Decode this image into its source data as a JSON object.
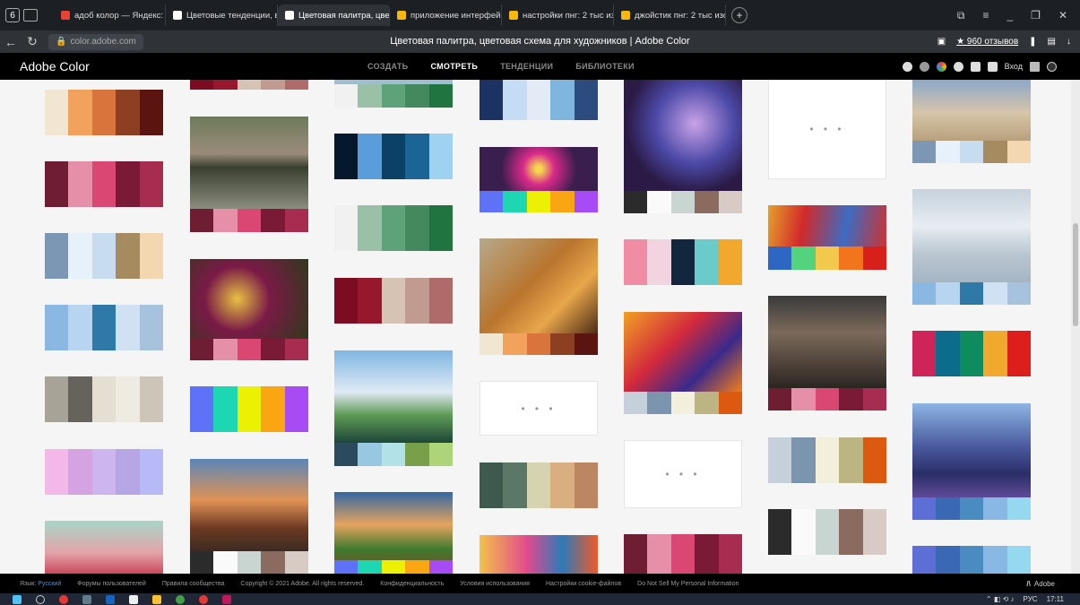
{
  "browser": {
    "tab_count": "6",
    "tabs": [
      {
        "label": "адоб колор — Яндекс: на",
        "color": "#e94234"
      },
      {
        "label": "Цветовые тенденции, вдо",
        "color": "#ffffff"
      },
      {
        "label": "Цветовая палитра, цве",
        "color": "#ffffff",
        "active": true
      },
      {
        "label": "приложение интерфейс:",
        "color": "#f6b80b"
      },
      {
        "label": "настройки пнг: 2 тыс изоб",
        "color": "#f6b80b"
      },
      {
        "label": "джойстик пнг: 2 тыс изоб",
        "color": "#f6b80b"
      }
    ],
    "url": "color.adobe.com",
    "page_title": "Цветовая палитра, цветовая схема для художников | Adobe Color",
    "reviews": "★ 960 отзывов"
  },
  "adobe": {
    "brand": "Adobe Color",
    "nav": [
      {
        "label": "СОЗДАТЬ",
        "active": false
      },
      {
        "label": "СМОТРЕТЬ",
        "active": true
      },
      {
        "label": "ТЕНДЕНЦИИ",
        "active": false
      },
      {
        "label": "БИБЛИОТЕКИ",
        "active": false
      }
    ],
    "login": "Вход"
  },
  "palettes": [
    [
      "#f1e6d2",
      "#f2a25d",
      "#d9743d",
      "#8d3f21",
      "#5c1410"
    ],
    [
      "#6e1d33",
      "#e58fa8",
      "#d94772",
      "#7a1a36",
      "#a62d50"
    ],
    [
      "#7c97b4",
      "#e7f1fb",
      "#c7dcef",
      "#a58b5f",
      "#f3d7b0"
    ],
    [
      "#8bb7e3",
      "#b7d4f1",
      "#2e79a8",
      "#cfe1f2",
      "#a6c2dd"
    ],
    [
      "#a8a398",
      "#66625c",
      "#e5dfd3",
      "#f0ebe2",
      "#cdc6b8"
    ],
    [
      "#f3b7e8",
      "#d5a3e1",
      "#cdb5f0",
      "#b6a6e6",
      "#b8baf7"
    ],
    [
      "#1b3263",
      "#c6dcf4",
      "#e3ecf6",
      "#7fb6e0",
      "#2c4b7e"
    ],
    [
      "#06182b",
      "#5a9ddb",
      "#0b4166",
      "#1a6596",
      "#9fd1f0"
    ],
    [
      "#f1f1f1",
      "#9ac1a8",
      "#5ea27a",
      "#42895d",
      "#1f7440"
    ],
    [
      "#7b0c21",
      "#97182c",
      "#d7c3b4",
      "#c19b8f",
      "#ae6b6a"
    ],
    [
      "#f08ca4",
      "#f1d4df",
      "#12273e",
      "#6bcbcb",
      "#f1a82c"
    ],
    [
      "#2e66c3",
      "#53d37c",
      "#f2c94c",
      "#f2751d",
      "#d8201b"
    ],
    [
      "#ce2459",
      "#0d6b8c",
      "#0e8c60",
      "#f0a92c",
      "#dc1f1c"
    ],
    [
      "#c5d0da",
      "#7a95ad",
      "#f2efdd",
      "#bdb483",
      "#db5a0f"
    ],
    [
      "#2b2b2b",
      "#fafafa",
      "#c9d5d1",
      "#8b6a60",
      "#d8cbc6"
    ],
    [
      "#5d6fd6",
      "#3a68b4",
      "#4a8bc2",
      "#89b8e5",
      "#95d9f1"
    ],
    [
      "#5d72f7",
      "#1dd6b2",
      "#ecf104",
      "#faa612",
      "#a74cf5"
    ],
    [
      "#2c4a5d",
      "#98c8e1",
      "#b2e1e7",
      "#78a04a",
      "#aed47a"
    ],
    [
      "#3e5a4f",
      "#5b7766",
      "#d6d3b0",
      "#d9ae80",
      "#bd8663"
    ]
  ],
  "placeholders_dots": "• • •",
  "footer": {
    "lang_label": "Язык:",
    "lang_value": "Русский",
    "links": [
      "Форумы пользователей",
      "Правила сообщества",
      "Copyright © 2021 Adobe. All rights reserved.",
      "Конфиденциальность",
      "Условия использования",
      "Настройки cookie-файлов",
      "Do Not Sell My Personal Information"
    ],
    "adobe": "Adobe"
  },
  "taskbar": {
    "lang": "РУС",
    "time": "17:11"
  }
}
